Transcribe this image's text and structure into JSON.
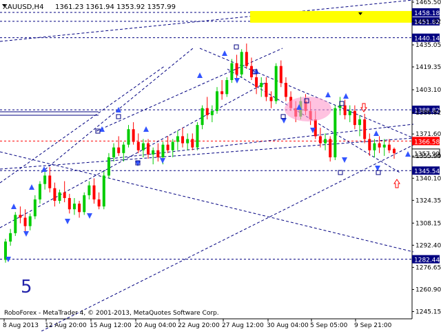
{
  "header": {
    "symbol": "XAUUSD,H4",
    "ohlc": "1361.23 1361.94 1353.92 1357.99"
  },
  "footer": {
    "copyright": "RoboForex - MetaTrader 4, © 2001-2013, MetaQuotes Software Corp."
  },
  "wave_label": "5",
  "colors": {
    "background": "#ffffff",
    "bull": "#00cc00",
    "bear": "#ff0000",
    "guide_lines": "#000080",
    "arrows": "#3355ff",
    "marker_up": "#ff0000",
    "price_label_bg": "#000080",
    "current_price_bg": "#ffffff",
    "highlight_zone": "#ffff00",
    "ellipse": "#ff99cc"
  },
  "chart_data": {
    "type": "candlestick",
    "x_tick_labels": [
      "8 Aug 2013",
      "12 Aug 20:00",
      "15 Aug 12:00",
      "20 Aug 04:00",
      "22 Aug 20:00",
      "27 Aug 12:00",
      "30 Aug 04:00",
      "5 Sep 05:00",
      "9 Sep 21:00"
    ],
    "y_tick_labels": [
      "1465.50",
      "1451.82",
      "1435.05",
      "1419.35",
      "1403.10",
      "1386.82",
      "1371.60",
      "1355.90",
      "1340.10",
      "1324.35",
      "1308.15",
      "1292.40",
      "1276.65",
      "1260.90",
      "1245.15"
    ],
    "ylim": [
      1240,
      1467
    ],
    "horizontal_levels": [
      {
        "value": 1458.18,
        "label": "1458.18",
        "style": "filled"
      },
      {
        "value": 1451.82,
        "label": "1451.82",
        "style": "filled"
      },
      {
        "value": 1440.14,
        "label": "1440.14",
        "style": "filled"
      },
      {
        "value": 1388.82,
        "label": "1388.82",
        "style": "filled"
      },
      {
        "value": 1366.58,
        "label": "1366.58",
        "style": "filled"
      },
      {
        "value": 1345.54,
        "label": "1345.54",
        "style": "filled"
      },
      {
        "value": 1282.44,
        "label": "1282.44",
        "style": "filled"
      },
      {
        "value": 1357.99,
        "label": "1357.99",
        "style": "current"
      }
    ],
    "candles": [
      [
        1282,
        1297,
        1280,
        1295
      ],
      [
        1295,
        1304,
        1292,
        1301
      ],
      [
        1301,
        1316,
        1299,
        1314
      ],
      [
        1314,
        1320,
        1308,
        1312
      ],
      [
        1312,
        1318,
        1302,
        1306
      ],
      [
        1306,
        1315,
        1303,
        1313
      ],
      [
        1313,
        1328,
        1311,
        1325
      ],
      [
        1325,
        1338,
        1322,
        1336
      ],
      [
        1336,
        1345,
        1332,
        1342
      ],
      [
        1342,
        1348,
        1330,
        1333
      ],
      [
        1333,
        1337,
        1320,
        1324
      ],
      [
        1324,
        1332,
        1322,
        1330
      ],
      [
        1330,
        1338,
        1323,
        1326
      ],
      [
        1326,
        1329,
        1315,
        1318
      ],
      [
        1318,
        1326,
        1314,
        1322
      ],
      [
        1322,
        1324,
        1312,
        1316
      ],
      [
        1316,
        1330,
        1314,
        1328
      ],
      [
        1328,
        1338,
        1325,
        1335
      ],
      [
        1335,
        1340,
        1322,
        1325
      ],
      [
        1325,
        1330,
        1318,
        1320
      ],
      [
        1320,
        1345,
        1318,
        1342
      ],
      [
        1342,
        1358,
        1340,
        1355
      ],
      [
        1355,
        1365,
        1352,
        1362
      ],
      [
        1362,
        1370,
        1356,
        1358
      ],
      [
        1358,
        1366,
        1352,
        1364
      ],
      [
        1364,
        1378,
        1362,
        1375
      ],
      [
        1375,
        1380,
        1364,
        1366
      ],
      [
        1366,
        1372,
        1358,
        1360
      ],
      [
        1360,
        1368,
        1355,
        1365
      ],
      [
        1365,
        1368,
        1354,
        1357
      ],
      [
        1357,
        1362,
        1350,
        1360
      ],
      [
        1360,
        1365,
        1352,
        1355
      ],
      [
        1355,
        1366,
        1350,
        1364
      ],
      [
        1364,
        1370,
        1358,
        1360
      ],
      [
        1360,
        1368,
        1355,
        1366
      ],
      [
        1366,
        1374,
        1360,
        1370
      ],
      [
        1370,
        1376,
        1362,
        1365
      ],
      [
        1365,
        1372,
        1360,
        1368
      ],
      [
        1368,
        1372,
        1360,
        1362
      ],
      [
        1362,
        1380,
        1360,
        1378
      ],
      [
        1378,
        1392,
        1375,
        1390
      ],
      [
        1390,
        1398,
        1382,
        1385
      ],
      [
        1385,
        1392,
        1380,
        1388
      ],
      [
        1388,
        1405,
        1386,
        1402
      ],
      [
        1402,
        1410,
        1396,
        1400
      ],
      [
        1400,
        1412,
        1398,
        1410
      ],
      [
        1410,
        1425,
        1408,
        1422
      ],
      [
        1422,
        1428,
        1410,
        1414
      ],
      [
        1414,
        1432,
        1412,
        1430
      ],
      [
        1430,
        1436,
        1418,
        1420
      ],
      [
        1420,
        1426,
        1410,
        1412
      ],
      [
        1412,
        1418,
        1400,
        1405
      ],
      [
        1405,
        1412,
        1398,
        1408
      ],
      [
        1408,
        1412,
        1395,
        1398
      ],
      [
        1398,
        1402,
        1390,
        1395
      ],
      [
        1395,
        1422,
        1393,
        1420
      ],
      [
        1420,
        1424,
        1405,
        1408
      ],
      [
        1408,
        1412,
        1395,
        1398
      ],
      [
        1398,
        1402,
        1388,
        1390
      ],
      [
        1390,
        1395,
        1380,
        1384
      ],
      [
        1384,
        1398,
        1382,
        1395
      ],
      [
        1395,
        1400,
        1385,
        1388
      ],
      [
        1388,
        1395,
        1378,
        1382
      ],
      [
        1382,
        1388,
        1368,
        1370
      ],
      [
        1370,
        1376,
        1362,
        1365
      ],
      [
        1365,
        1372,
        1360,
        1368
      ],
      [
        1368,
        1370,
        1352,
        1355
      ],
      [
        1355,
        1392,
        1353,
        1390
      ],
      [
        1390,
        1398,
        1385,
        1392
      ],
      [
        1392,
        1396,
        1382,
        1385
      ],
      [
        1385,
        1392,
        1380,
        1388
      ],
      [
        1388,
        1392,
        1375,
        1378
      ],
      [
        1378,
        1385,
        1370,
        1382
      ],
      [
        1382,
        1386,
        1365,
        1368
      ],
      [
        1368,
        1372,
        1356,
        1360
      ],
      [
        1360,
        1368,
        1355,
        1365
      ],
      [
        1365,
        1370,
        1358,
        1362
      ],
      [
        1362,
        1368,
        1356,
        1364
      ],
      [
        1364,
        1368,
        1358,
        1360
      ],
      [
        1361,
        1362,
        1354,
        1358
      ]
    ]
  }
}
